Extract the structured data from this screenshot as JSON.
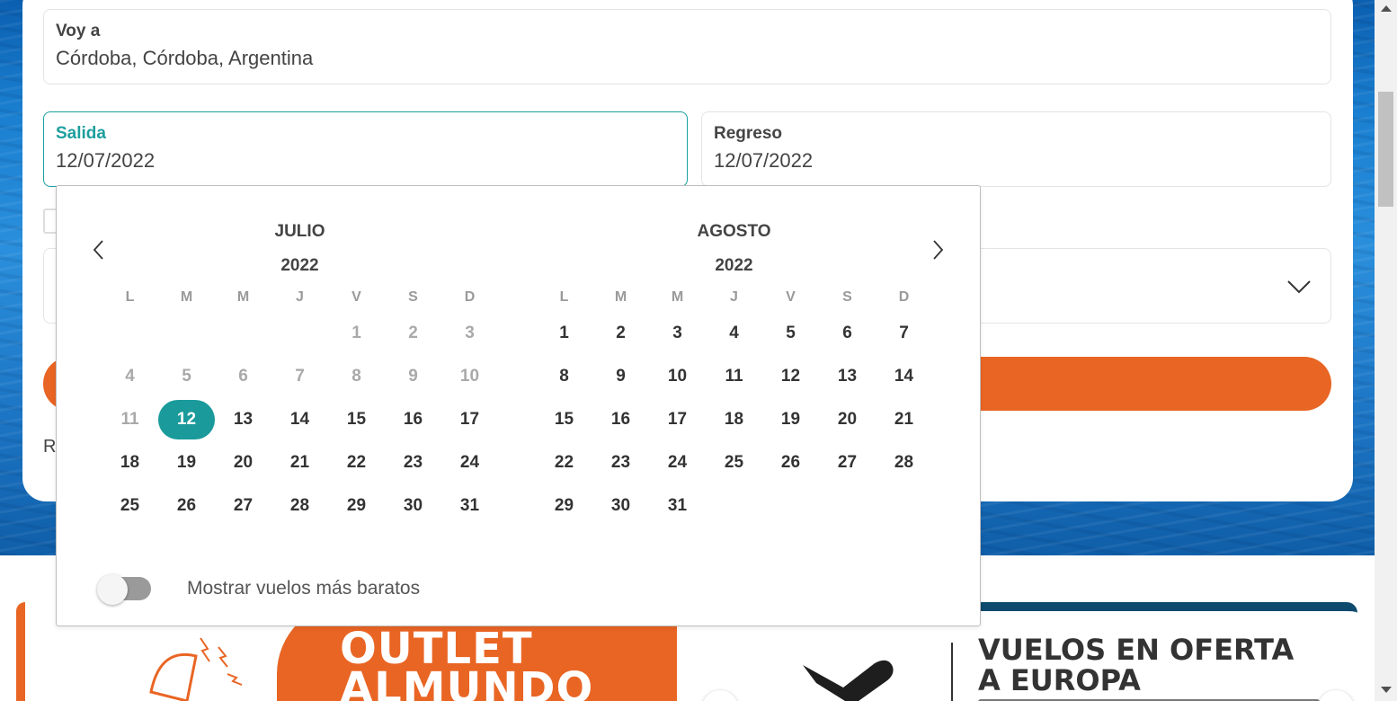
{
  "search": {
    "destination": {
      "label": "Voy a",
      "value": "Córdoba, Córdoba, Argentina"
    },
    "departure": {
      "label": "Salida",
      "value": "12/07/2022"
    },
    "return": {
      "label": "Regreso",
      "value": "12/07/2022"
    },
    "partial_label": "R"
  },
  "calendar": {
    "weekdays": [
      "L",
      "M",
      "M",
      "J",
      "V",
      "S",
      "D"
    ],
    "months": [
      {
        "name": "JULIO",
        "year": "2022",
        "leading_blanks": 4,
        "days": [
          1,
          2,
          3,
          4,
          5,
          6,
          7,
          8,
          9,
          10,
          11,
          12,
          13,
          14,
          15,
          16,
          17,
          18,
          19,
          20,
          21,
          22,
          23,
          24,
          25,
          26,
          27,
          28,
          29,
          30,
          31
        ],
        "disabled_until": 11,
        "selected": 12
      },
      {
        "name": "AGOSTO",
        "year": "2022",
        "leading_blanks": 0,
        "days": [
          1,
          2,
          3,
          4,
          5,
          6,
          7,
          8,
          9,
          10,
          11,
          12,
          13,
          14,
          15,
          16,
          17,
          18,
          19,
          20,
          21,
          22,
          23,
          24,
          25,
          26,
          27,
          28,
          29,
          30,
          31
        ],
        "disabled_until": 0,
        "selected": null
      }
    ],
    "toggle": {
      "label": "Mostrar vuelos más baratos",
      "on": false
    }
  },
  "banners": {
    "outlet": {
      "line1": "OUTLET",
      "line2": "ALMUNDO"
    },
    "europe": {
      "line1": "VUELOS EN OFERTA",
      "line2": "A EUROPA"
    }
  },
  "colors": {
    "accent": "#1a9a9a",
    "brand_orange": "#e96524",
    "banner_dark": "#0d4a6e"
  }
}
